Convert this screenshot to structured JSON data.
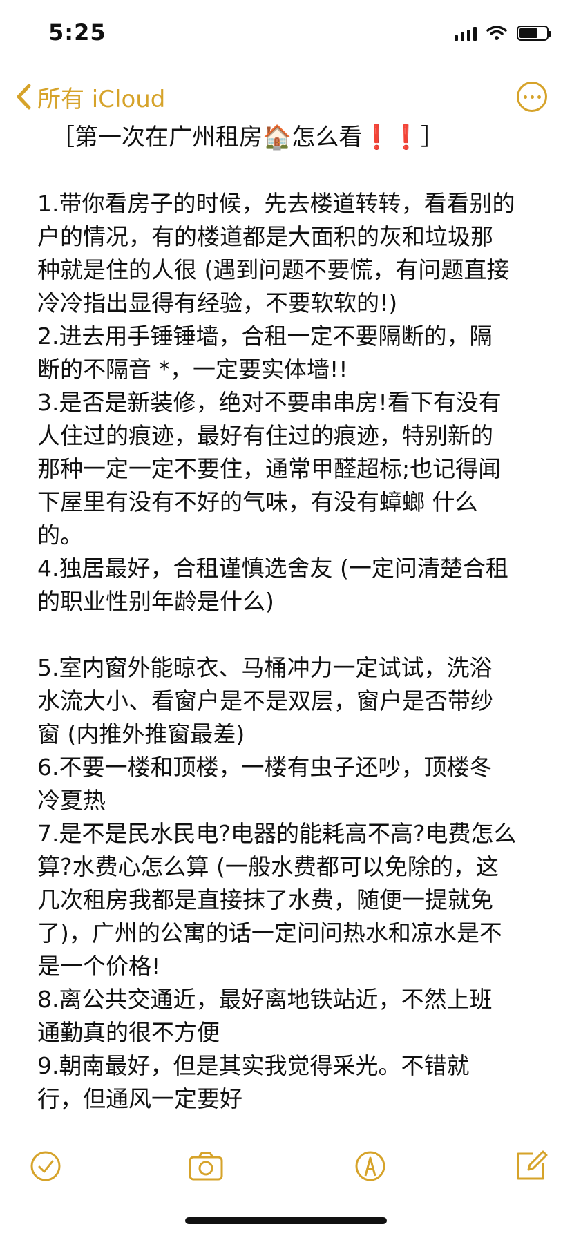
{
  "status_bar": {
    "time": "5:25"
  },
  "nav": {
    "back_label": "所有 iCloud"
  },
  "note": {
    "title": "［第一次在广州租房🏠怎么看❗️❗️］",
    "lines": [
      "1.带你看房子的时候，先去楼道转转，看看别的",
      "户的情况，有的楼道都是大面积的灰和垃圾那",
      "种就是住的人很 (遇到问题不要慌，有问题直接",
      "冷冷指出显得有经验，不要软软的!)",
      "2.进去用手锤锤墙，合租一定不要隔断的，隔",
      "断的不隔音 *，一定要实体墙!!",
      "3.是否是新装修，绝对不要串串房!看下有没有",
      "人住过的痕迹，最好有住过的痕迹，特别新的",
      "那种一定一定不要住，通常甲醛超标;也记得闻",
      "下屋里有没有不好的气味，有没有蟑螂 什么",
      "的。",
      "4.独居最好，合租谨慎选舍友 (一定问清楚合租",
      "的职业性别年龄是什么)",
      "",
      "5.室内窗外能晾衣、马桶冲力一定试试，洗浴",
      "水流大小、看窗户是不是双层，窗户是否带纱",
      "窗 (内推外推窗最差)",
      "6.不要一楼和顶楼，一楼有虫子还吵，顶楼冬",
      "冷夏热",
      "7.是不是民水民电?电器的能耗高不高?电费怎么",
      "算?水费心怎么算 (一般水费都可以免除的，这",
      "几次租房我都是直接抹了水费，随便一提就免",
      "了)，广州的公寓的话一定问问热水和凉水是不",
      "是一个价格!",
      "8.离公共交通近，最好离地铁站近，不然上班",
      "通勤真的很不方便",
      "9.朝南最好，但是其实我觉得采光。不错就",
      "行，但通风一定要好"
    ]
  },
  "toolbar": {
    "icons": [
      "checklist-icon",
      "camera-icon",
      "markup-icon",
      "compose-icon"
    ]
  },
  "colors": {
    "accent": "#d6a32a",
    "text": "#111111",
    "background": "#ffffff"
  }
}
